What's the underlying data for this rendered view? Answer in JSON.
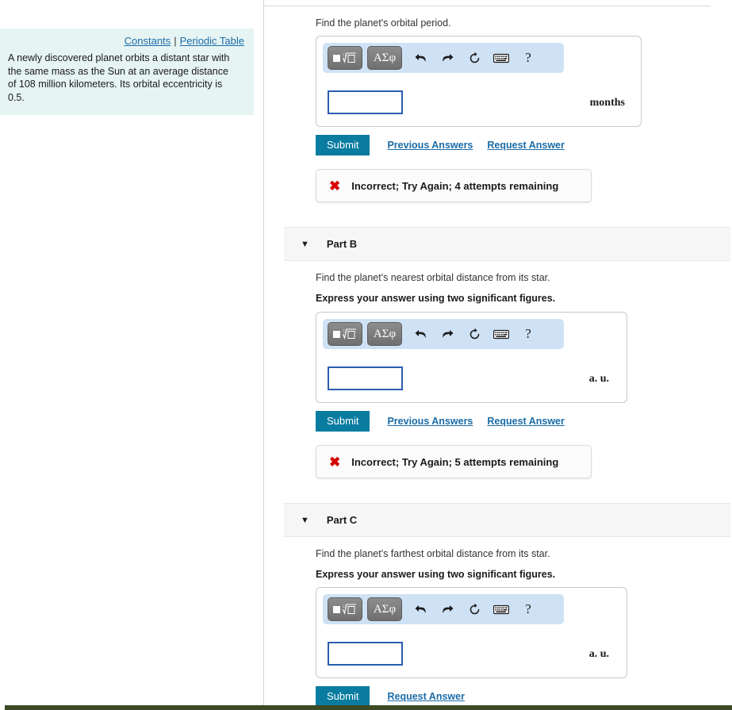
{
  "left_panel": {
    "links": {
      "constants": "Constants",
      "separator": "|",
      "periodic_table": "Periodic Table"
    },
    "problem_statement": "A newly discovered planet orbits a distant star with the same mass as the Sun at an average distance of 108 million kilometers. Its orbital eccentricity is 0.5."
  },
  "toolbar": {
    "math_template_label": "■√□",
    "greek_label": "ΑΣφ",
    "undo_icon": "undo-arrow",
    "redo_icon": "redo-arrow",
    "reset_icon": "reset-circular-arrow",
    "keyboard_icon": "keyboard",
    "help_label": "?"
  },
  "common": {
    "submit_label": "Submit",
    "previous_answers_label": "Previous Answers",
    "request_answer_label": "Request Answer",
    "caret": "▼",
    "x_mark": "✖"
  },
  "colors": {
    "submit_teal": "#0a7ca0",
    "link_blue": "#1b6ca8",
    "panel_cyan": "#e6f4f3",
    "mathbar_blue": "#cfe2f5",
    "error_red": "#d50000",
    "band_grey": "#f6f6f6",
    "input_border_blue": "#2a5db0",
    "footer_olive": "#3c4a23"
  },
  "parts": [
    {
      "id": "part-a",
      "title": "",
      "prompt": "Find the planet's orbital period.",
      "sigfig_note": "",
      "answer_value": "",
      "unit": "months",
      "has_previous_answers": true,
      "feedback": "Incorrect; Try Again; 4 attempts remaining"
    },
    {
      "id": "part-b",
      "title": "Part B",
      "prompt": "Find the planet's nearest orbital distance from its star.",
      "sigfig_note": "Express your answer using two significant figures.",
      "answer_value": "",
      "unit": "a. u.",
      "has_previous_answers": true,
      "feedback": "Incorrect; Try Again; 5 attempts remaining"
    },
    {
      "id": "part-c",
      "title": "Part C",
      "prompt": "Find the planet's farthest orbital distance from its star.",
      "sigfig_note": "Express your answer using two significant figures.",
      "answer_value": "",
      "unit": "a. u.",
      "has_previous_answers": false,
      "feedback": ""
    }
  ]
}
